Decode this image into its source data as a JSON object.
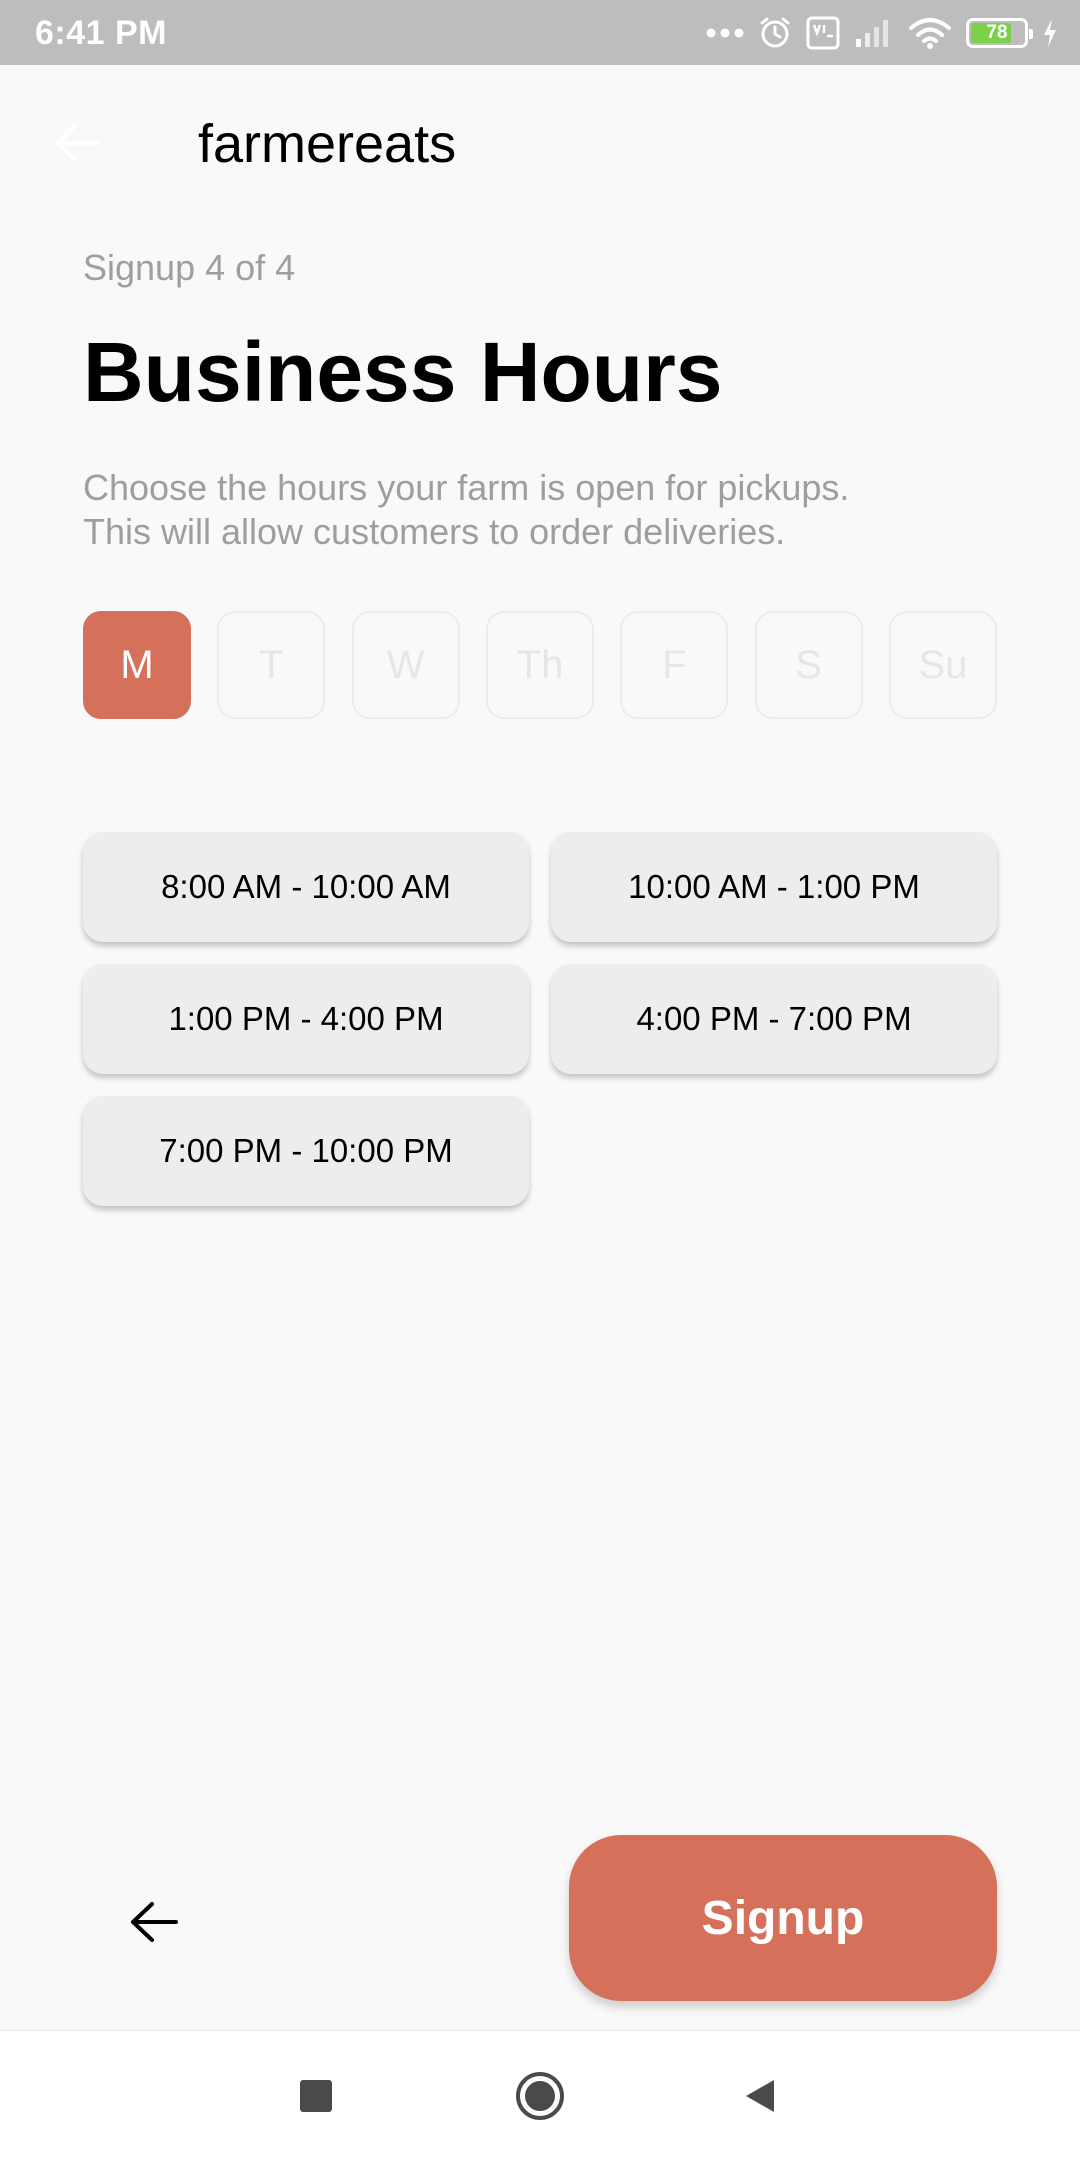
{
  "status_bar": {
    "time": "6:41 PM",
    "battery": "78",
    "battery_level": 0.78,
    "icons": [
      "more-dots-icon",
      "alarm-icon",
      "volte-icon",
      "signal-icon",
      "wifi-icon",
      "battery-icon",
      "charging-icon"
    ]
  },
  "header": {
    "back_icon": "arrow-left-icon",
    "app_name": "farmereats"
  },
  "step_label": "Signup 4 of 4",
  "title": "Business Hours",
  "description": {
    "line1": "Choose the hours your farm is open for pickups.",
    "line2": "This will allow customers to order deliveries."
  },
  "days": [
    {
      "label": "M",
      "selected": true
    },
    {
      "label": "T",
      "selected": false
    },
    {
      "label": "W",
      "selected": false
    },
    {
      "label": "Th",
      "selected": false
    },
    {
      "label": "F",
      "selected": false
    },
    {
      "label": "S",
      "selected": false
    },
    {
      "label": "Su",
      "selected": false
    }
  ],
  "time_slots": [
    "8:00 AM - 10:00 AM",
    "10:00 AM - 1:00 PM",
    "1:00 PM - 4:00 PM",
    "4:00 PM - 7:00 PM",
    "7:00 PM - 10:00 PM"
  ],
  "footer": {
    "back_icon": "arrow-left-icon",
    "signup_label": "Signup"
  },
  "nav_bar": {
    "icons": [
      "recents-square-icon",
      "home-circle-icon",
      "back-triangle-icon"
    ]
  },
  "colors": {
    "accent": "#d5705a",
    "slot_background": "#eeedec",
    "muted_text": "#9e9e9e",
    "status_bar": "#bdbdbd"
  }
}
